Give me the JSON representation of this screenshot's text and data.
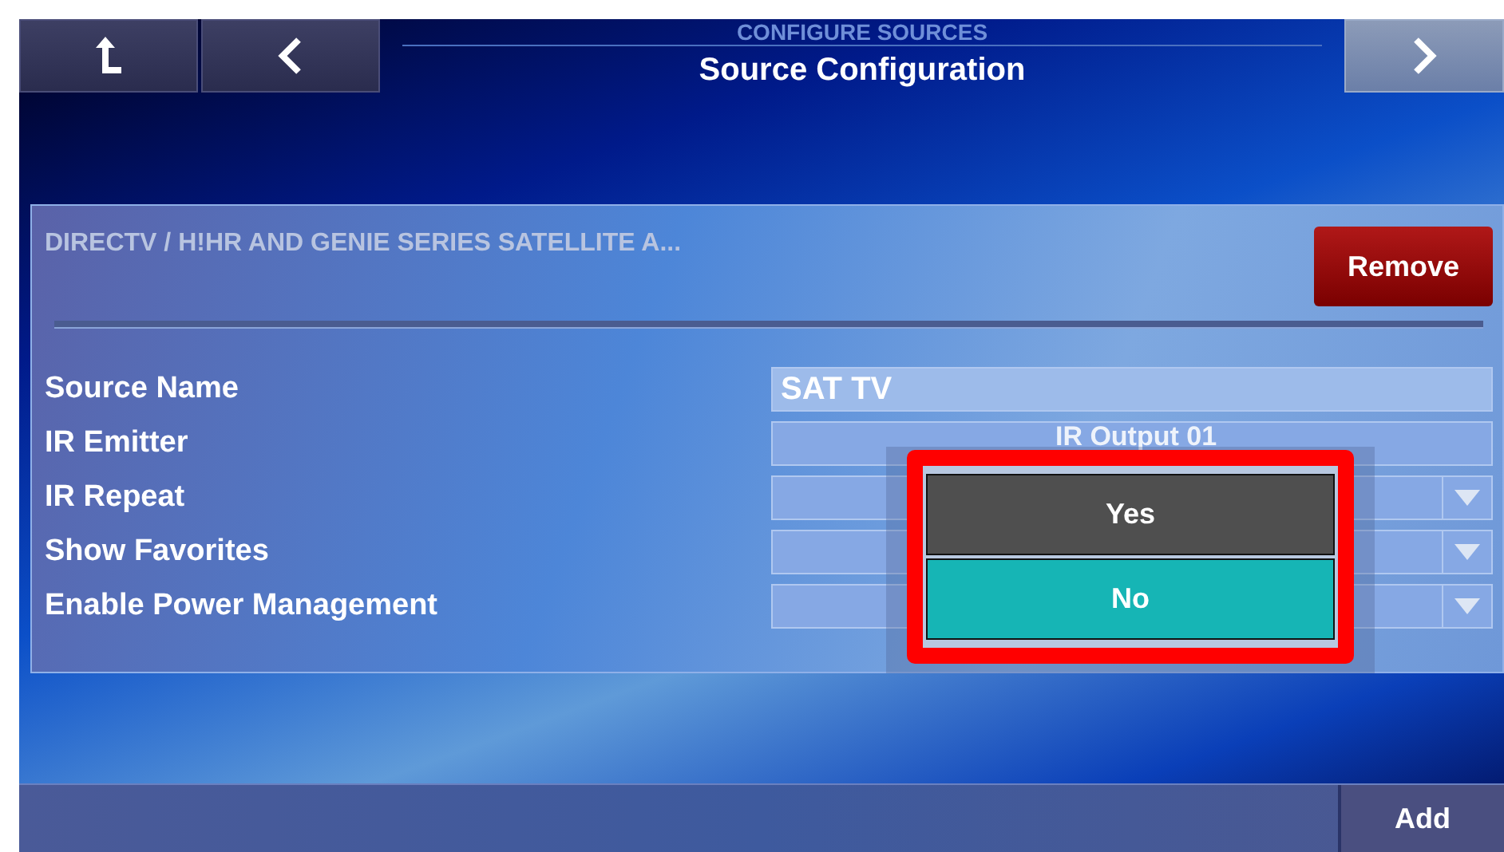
{
  "header": {
    "subtitle": "CONFIGURE SOURCES",
    "title": "Source Configuration",
    "nav": [
      {
        "kind": "up"
      },
      {
        "kind": "back"
      },
      {
        "kind": "forward"
      }
    ]
  },
  "panel": {
    "device": "DIRECTV / H!HR AND GENIE SERIES SATELLITE A...",
    "remove_button": "Remove",
    "fields": [
      {
        "label": "Source Name",
        "kind": "text",
        "value": "SAT TV"
      },
      {
        "label": "IR Emitter",
        "kind": "button",
        "value": "IR Output 01"
      },
      {
        "label": "IR Repeat",
        "kind": "select"
      },
      {
        "label": "Show Favorites",
        "kind": "select"
      },
      {
        "label": "Enable Power Management",
        "kind": "select"
      }
    ]
  },
  "popup": {
    "highlighted": true,
    "options": [
      {
        "label": "Yes",
        "selected": false
      },
      {
        "label": "No",
        "selected": true
      }
    ]
  },
  "footer": {
    "add_button": "Add"
  }
}
